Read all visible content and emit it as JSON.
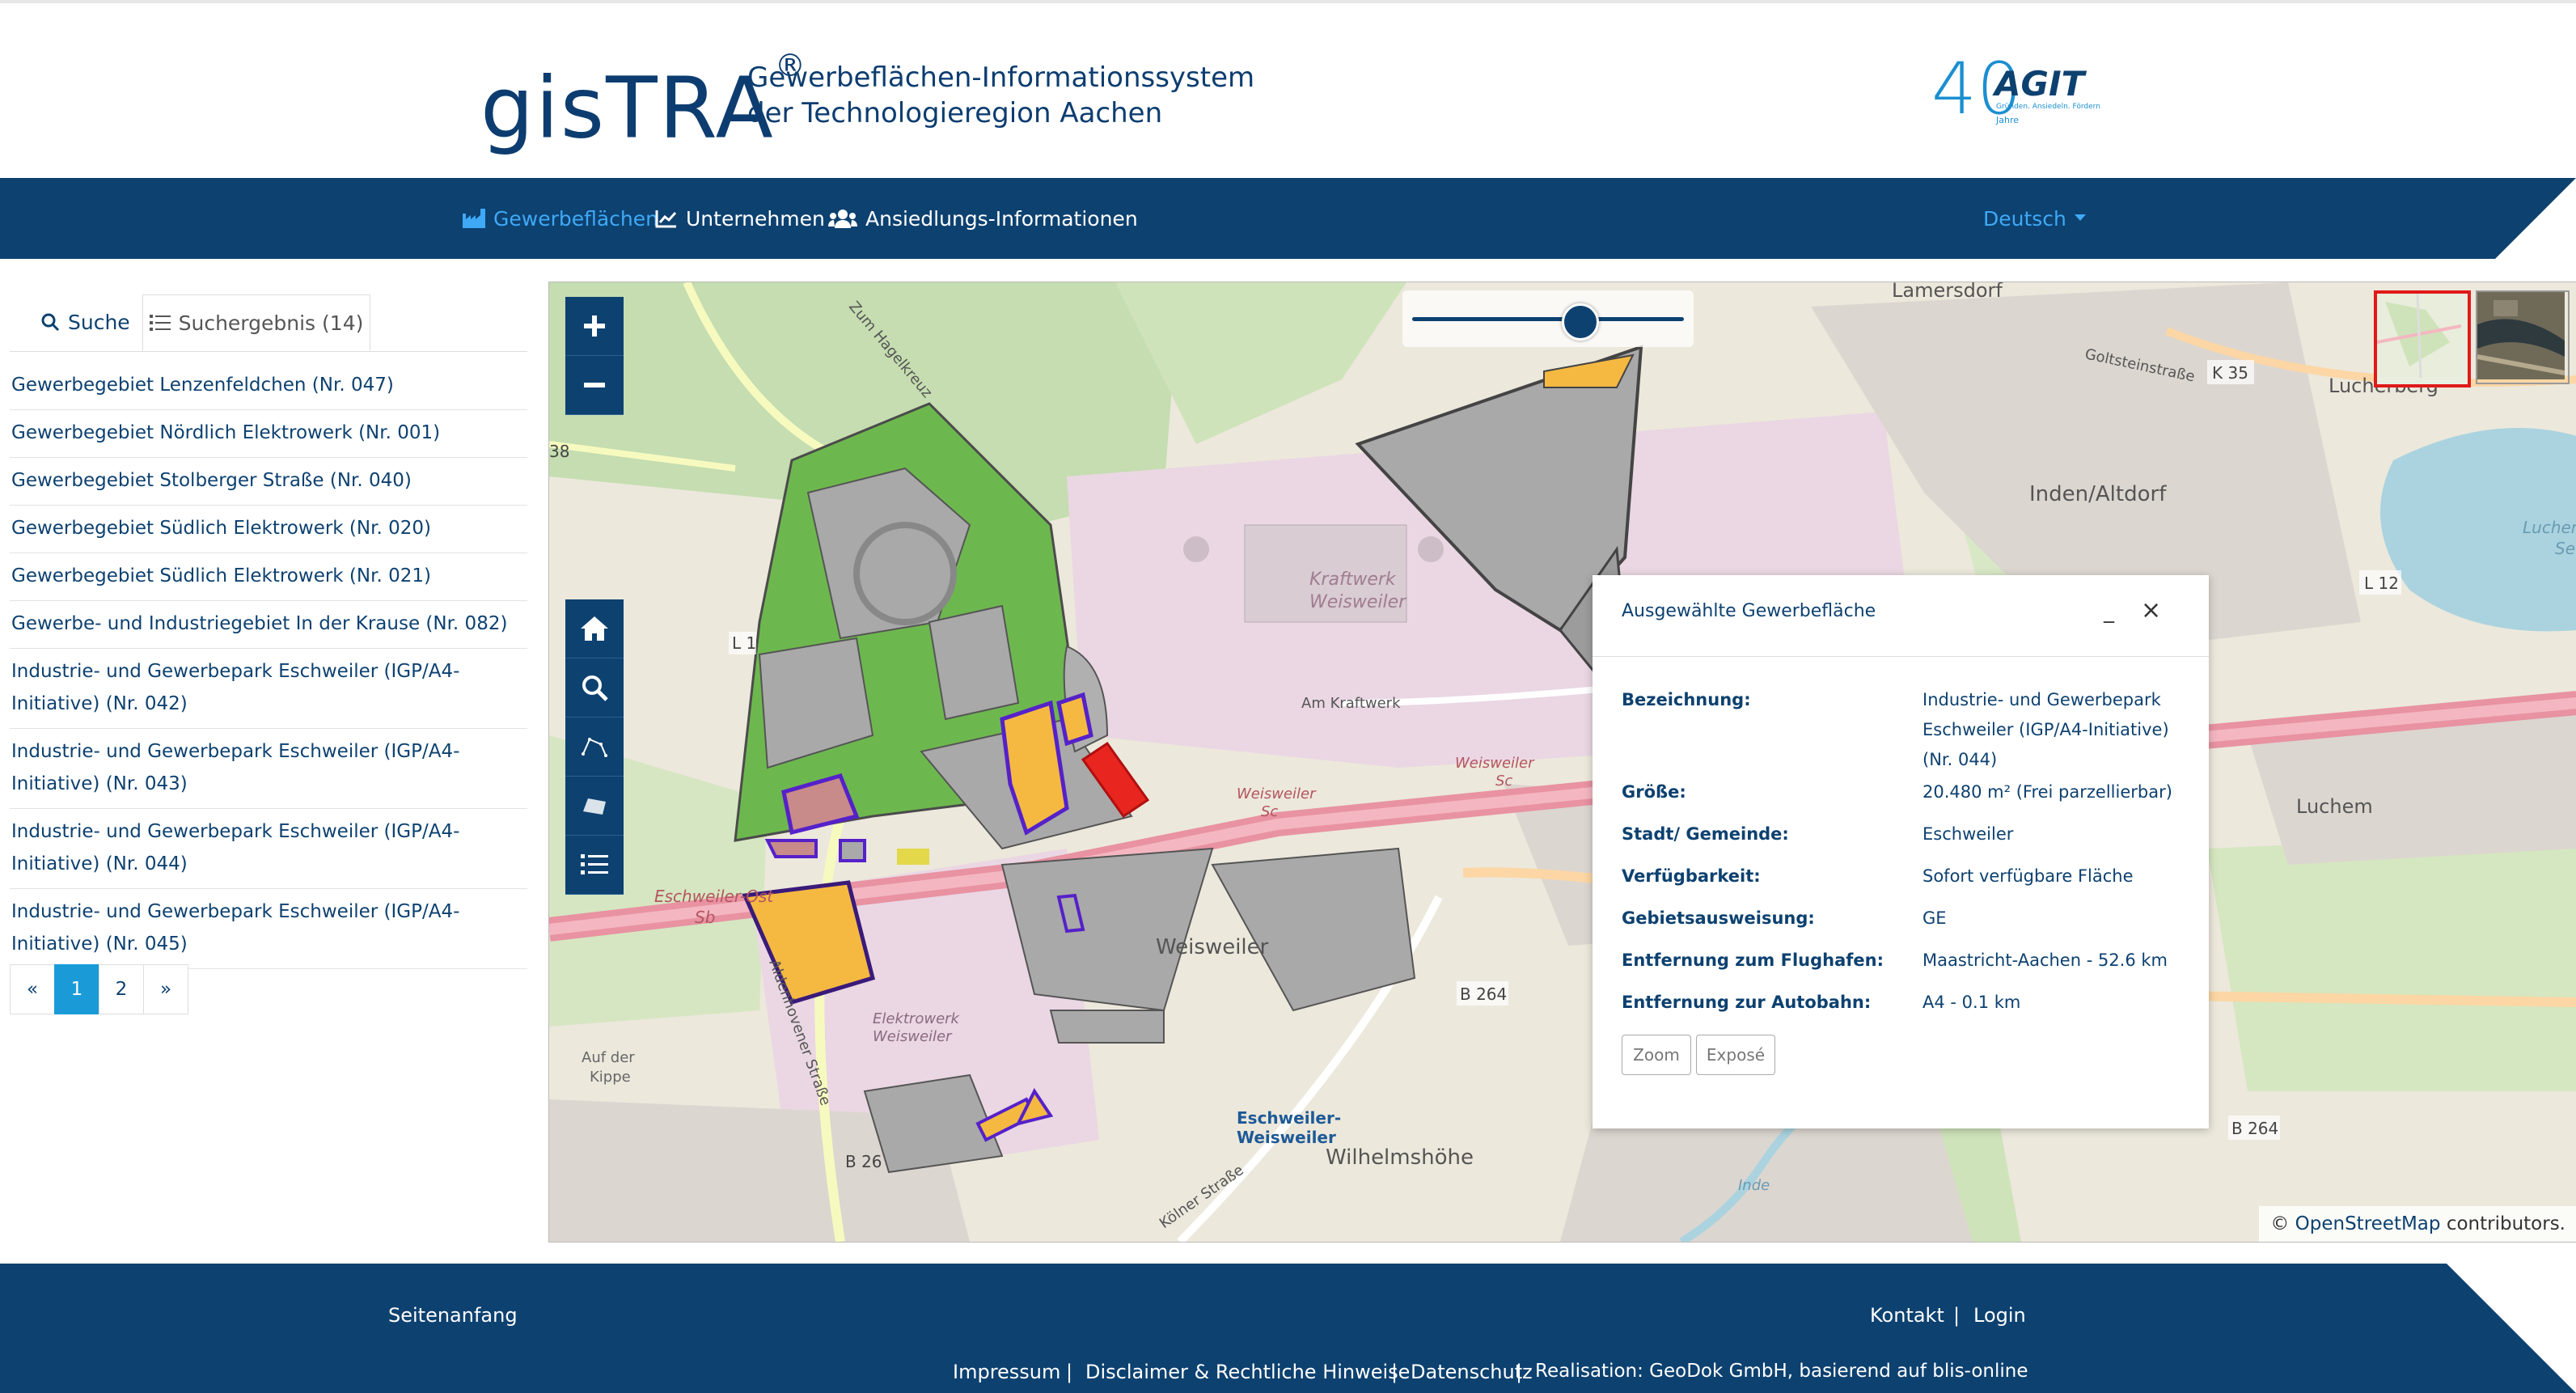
{
  "header": {
    "logo_text": "gisTRA",
    "logo_reg": "®",
    "subtitle_line1": "Gewerbeflächen-Informationssystem",
    "subtitle_line2": "der Technologieregion Aachen",
    "partner_logo": "AGIT",
    "partner_years": "40",
    "partner_tagline": "Gründen. Ansiedeln. Fördern.",
    "partner_jahre": "Jahre"
  },
  "nav": {
    "items": [
      {
        "label": "Gewerbeflächen",
        "icon": "industry-icon",
        "active": true
      },
      {
        "label": "Unternehmen",
        "icon": "line-chart-icon",
        "active": false
      },
      {
        "label": "Ansiedlungs-Informationen",
        "icon": "users-icon",
        "active": false
      }
    ],
    "language": "Deutsch"
  },
  "sidebar": {
    "tabs": [
      {
        "label": "Suche",
        "icon": "search-icon"
      },
      {
        "label": "Suchergebnis (14)",
        "icon": "list-icon"
      }
    ],
    "results": [
      "Gewerbegebiet Lenzenfeldchen (Nr. 047)",
      "Gewerbegebiet Nördlich Elektrowerk (Nr. 001)",
      "Gewerbegebiet Stolberger Straße (Nr. 040)",
      "Gewerbegebiet Südlich Elektrowerk (Nr. 020)",
      "Gewerbegebiet Südlich Elektrowerk (Nr. 021)",
      "Gewerbe- und Industriegebiet In der Krause (Nr. 082)",
      "Industrie- und Gewerbepark Eschweiler (IGP/A4-Initiative) (Nr. 042)",
      "Industrie- und Gewerbepark Eschweiler (IGP/A4-Initiative) (Nr. 043)",
      "Industrie- und Gewerbepark Eschweiler (IGP/A4-Initiative) (Nr. 044)",
      "Industrie- und Gewerbepark Eschweiler (IGP/A4-Initiative) (Nr. 045)"
    ],
    "pagination": {
      "prev": "«",
      "pages": [
        "1",
        "2"
      ],
      "current": "1",
      "next": "»"
    }
  },
  "map": {
    "labels": {
      "lamersdorf": "Lamersdorf",
      "golt": "Goltsteinstraße",
      "k35": "K 35",
      "lucherberg": "Lucherberg",
      "inden": "Inden/Altdorf",
      "kraftwerk": "Kraftwerk",
      "weisweiler_kw": "Weisweiler",
      "am_kraftwerk": "Am Kraftwerk",
      "l12": "L 12",
      "luchem": "Luchem",
      "weisweiler": "Weisweiler",
      "elektrowerk": "Elektrowerk",
      "elektrowerk2": "Weisweiler",
      "auf_der": "Auf der",
      "kippe": "Kippe",
      "b264": "B 264",
      "b264b": "B 264",
      "eschweiler_weisweiler": "Eschweiler-",
      "eschweiler_weisweiler2": "Weisweiler",
      "wilhelmshoehe": "Wilhelmshöhe",
      "koelner": "Kölner Straße",
      "l1": "L 1",
      "n38": "38",
      "b26": "B 26",
      "zum_hagelkreuz": "Zum Hagelkreuz",
      "aldenhovener": "Aldenhovener Straße",
      "eschweiler_ost": "Eschweiler-Ost",
      "sb": "Sb",
      "weisweiler_sc": "Weisweiler",
      "sc": "Sc",
      "weisweiler_sc2": "Weisweiler",
      "sc2": "Sc",
      "inde": "Inde",
      "lucher": "Lucher",
      "se": "Se"
    },
    "opacity_slider": 0.62,
    "attribution_prefix": "©",
    "attribution_link": "OpenStreetMap",
    "attribution_suffix": "contributors."
  },
  "popup": {
    "title": "Ausgewählte Gewerbefläche",
    "minimize": "_",
    "close": "×",
    "rows": [
      {
        "label": "Bezeichnung:",
        "value": "Industrie- und Gewerbepark Eschweiler (IGP/A4-Initiative) (Nr. 044)"
      },
      {
        "label": "Größe:",
        "value": "20.480 m² (Frei parzellierbar)"
      },
      {
        "label": "Stadt/ Gemeinde:",
        "value": "Eschweiler"
      },
      {
        "label": "Verfügbarkeit:",
        "value": "Sofort verfügbare Fläche"
      },
      {
        "label": "Gebietsausweisung:",
        "value": "GE"
      },
      {
        "label": "Entfernung zum Flughafen:",
        "value": "Maastricht-Aachen - 52.6 km"
      },
      {
        "label": "Entfernung zur Autobahn:",
        "value": "A4 - 0.1 km"
      }
    ],
    "zoom_button": "Zoom",
    "expose_button": "Exposé"
  },
  "footer": {
    "top_link": "Seitenanfang",
    "kontakt": "Kontakt",
    "sep": "|",
    "login": "Login",
    "links": [
      "Impressum",
      "Disclaimer & Rechtliche Hinweise",
      "Datenschutz",
      "Realisation: GeoDok GmbH,  basierend auf blis-online"
    ]
  }
}
